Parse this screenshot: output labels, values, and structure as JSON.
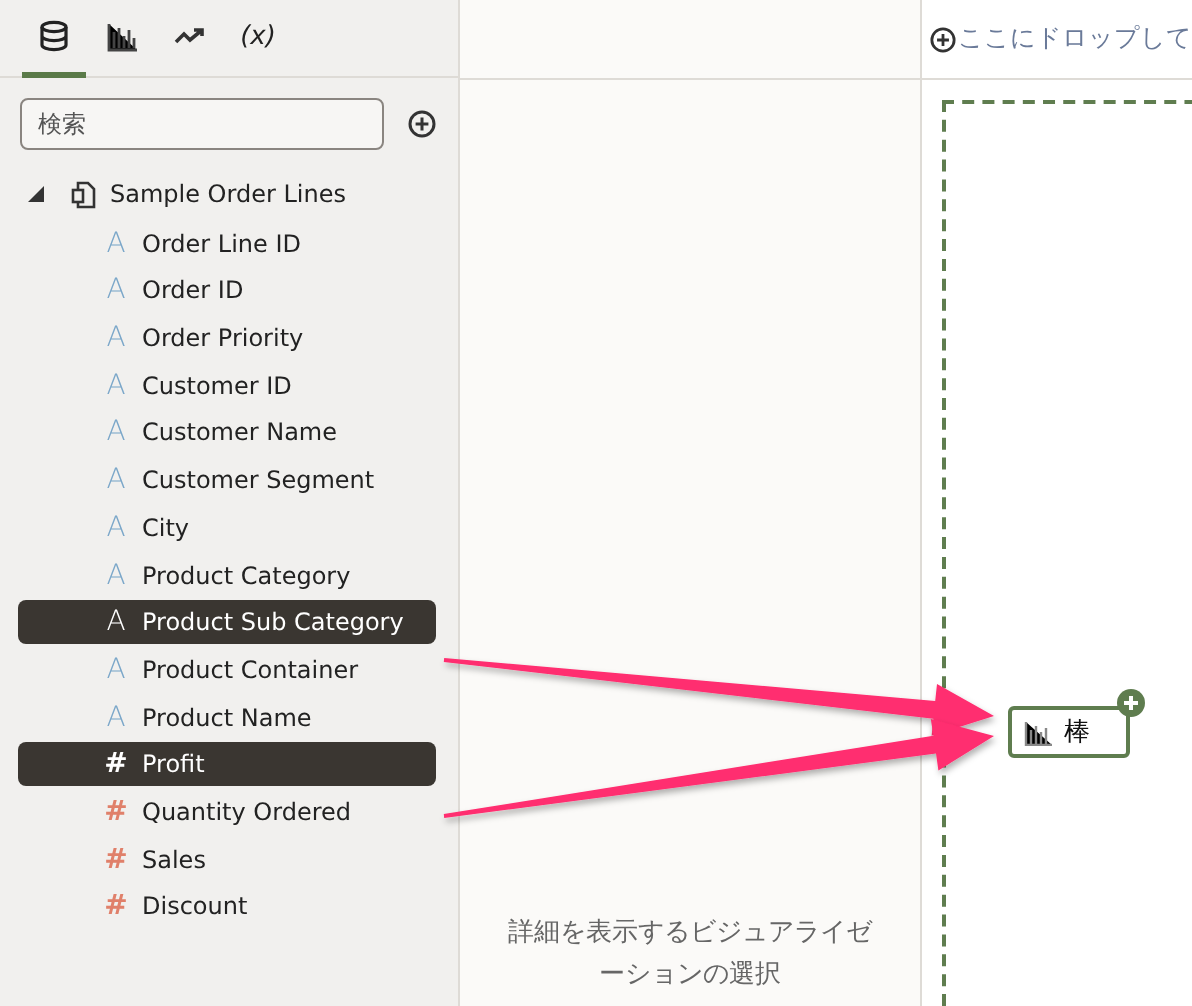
{
  "sidebar": {
    "tabs": [
      {
        "kind": "data",
        "selected": true
      },
      {
        "kind": "visualizations",
        "selected": false
      },
      {
        "kind": "analytics",
        "selected": false
      },
      {
        "kind": "calculations",
        "label": "(x)",
        "selected": false
      }
    ],
    "search": {
      "placeholder": "検索"
    },
    "tree": {
      "label": "Sample Order Lines",
      "expanded": true,
      "children": [
        {
          "icon": "A",
          "label": "Order Line ID",
          "kind": "attribute",
          "selected": false
        },
        {
          "icon": "A",
          "label": "Order ID",
          "kind": "attribute",
          "selected": false
        },
        {
          "icon": "A",
          "label": "Order Priority",
          "kind": "attribute",
          "selected": false
        },
        {
          "icon": "A",
          "label": "Customer ID",
          "kind": "attribute",
          "selected": false
        },
        {
          "icon": "A",
          "label": "Customer Name",
          "kind": "attribute",
          "selected": false
        },
        {
          "icon": "A",
          "label": "Customer Segment",
          "kind": "attribute",
          "selected": false
        },
        {
          "icon": "A",
          "label": "City",
          "kind": "attribute",
          "selected": false
        },
        {
          "icon": "A",
          "label": "Product Category",
          "kind": "attribute",
          "selected": false
        },
        {
          "icon": "A",
          "label": "Product Sub Category",
          "kind": "attribute",
          "selected": true
        },
        {
          "icon": "A",
          "label": "Product Container",
          "kind": "attribute",
          "selected": false
        },
        {
          "icon": "A",
          "label": "Product Name",
          "kind": "attribute",
          "selected": false
        },
        {
          "icon": "#",
          "label": "Profit",
          "kind": "measure",
          "selected": true
        },
        {
          "icon": "#",
          "label": "Quantity Ordered",
          "kind": "measure",
          "selected": false
        },
        {
          "icon": "#",
          "label": "Sales",
          "kind": "measure",
          "selected": false
        },
        {
          "icon": "#",
          "label": "Discount",
          "kind": "measure",
          "selected": false
        }
      ]
    }
  },
  "middle": {
    "hint": "詳細を表示するビジュアライゼーションの選択"
  },
  "canvas": {
    "drop_hint": "ここにドロップして",
    "chip": {
      "label": "棒"
    }
  }
}
